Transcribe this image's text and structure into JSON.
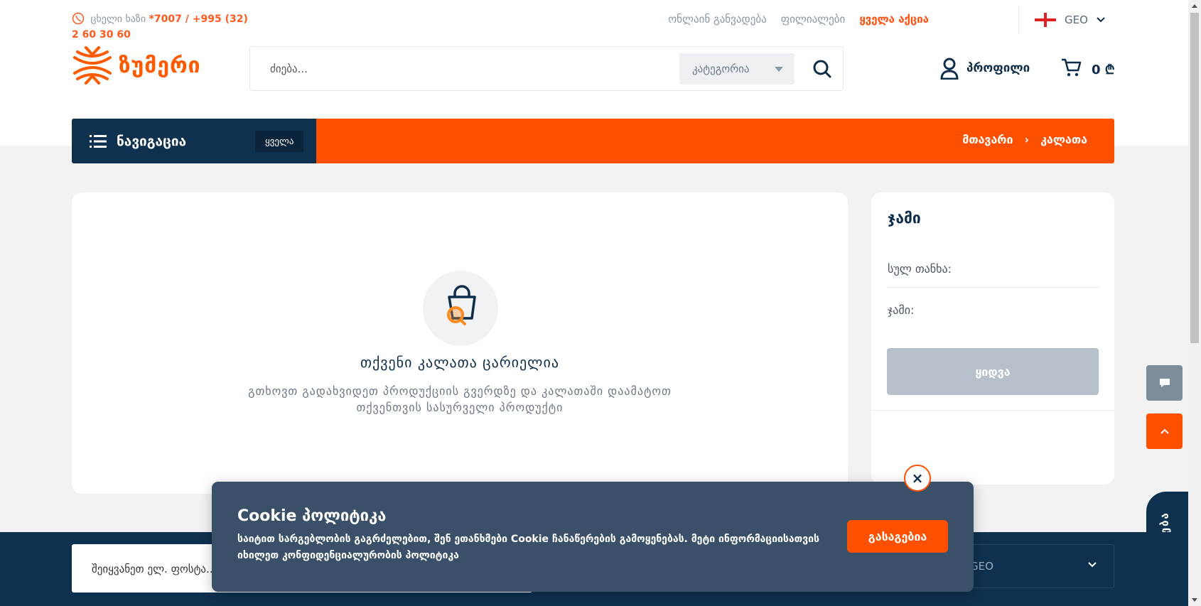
{
  "topbar": {
    "hotline_label": "ცხელი ხაზი",
    "hotline_number": "*7007 / +995 (32) 2 60 30 60",
    "links": [
      "ონლაინ განვადება",
      "ფილიალები"
    ],
    "promo_link": "ყველა აქცია",
    "language": "GEO"
  },
  "header": {
    "logo_text": "ზუმერი",
    "search_placeholder": "ძიება...",
    "category_label": "კატეგორია",
    "profile_label": "პროფილი",
    "cart_total": "0 ₾"
  },
  "navbar": {
    "title": "ნავიგაცია",
    "all_label": "ყველა",
    "breadcrumb": [
      "მთავარი",
      "კალათა"
    ],
    "breadcrumb_separator": "›"
  },
  "cart": {
    "empty_title": "თქვენი კალათა ცარიელია",
    "empty_description": "გთხოვთ გადახვიდეთ პროდუქციის გვერდზე და კალათაში დაამატოთ თქვენთვის სასურველი პროდუქტი"
  },
  "summary": {
    "title": "ჯამი",
    "subtotal_label": "სულ თანხა:",
    "total_label": "ჯამი:",
    "buy_label": "ყიდვა"
  },
  "side": {
    "compare_label": "შედარება"
  },
  "footer": {
    "newsletter_placeholder": "შეიყვანეთ ელ. ფოსტა...",
    "language": "GEO"
  },
  "cookie": {
    "title": "Cookie პოლიტიკა",
    "text": "საიტით სარგებლობის გაგრძელებით, შენ ეთანხმები Cookie ჩანაწერების გამოყენებას. მეტი ინფორმაციისათვის იხილეთ",
    "link_text": "კონფიდენციალურობის პოლიტიკა",
    "accept_label": "გასაგებია",
    "close_symbol": "×"
  },
  "colors": {
    "accent": "#ff5000",
    "navy": "#0e3150",
    "disabled_button": "#b5c0ca"
  }
}
